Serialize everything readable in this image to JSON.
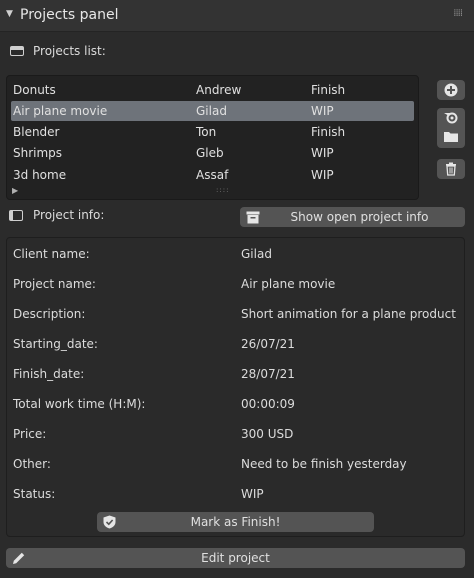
{
  "panel": {
    "title": "Projects panel"
  },
  "projects_list": {
    "label": "Projects list:",
    "rows": [
      {
        "name": "Donuts",
        "client": "Andrew",
        "status": "Finish"
      },
      {
        "name": "Air plane movie",
        "client": "Gilad",
        "status": "WIP"
      },
      {
        "name": "Blender",
        "client": "Ton",
        "status": "Finish"
      },
      {
        "name": "Shrimps",
        "client": "Gleb",
        "status": "WIP"
      },
      {
        "name": "3d home",
        "client": "Assaf",
        "status": "WIP"
      }
    ],
    "selected_index": 1
  },
  "side_buttons": {
    "add": "plus-circle-icon",
    "blender": "blender-logo-icon",
    "folder": "folder-icon",
    "delete": "trash-icon"
  },
  "project_info": {
    "label": "Project info:",
    "show_button": "Show open project info",
    "fields": [
      {
        "key": "Client name:",
        "value": "Gilad"
      },
      {
        "key": "Project name:",
        "value": "Air plane movie"
      },
      {
        "key": "Description:",
        "value": "Short animation for a plane product"
      },
      {
        "key": "Starting_date:",
        "value": "26/07/21"
      },
      {
        "key": "Finish_date:",
        "value": "28/07/21"
      },
      {
        "key": "Total work time (H:M):",
        "value": "00:00:09"
      },
      {
        "key": "Price:",
        "value": "300 USD"
      },
      {
        "key": "Other:",
        "value": "Need to be finish yesterday"
      },
      {
        "key": "Status:",
        "value": "WIP"
      }
    ],
    "mark_button": "Mark as Finish!"
  },
  "footer": {
    "edit_button": "Edit project"
  },
  "colors": {
    "background": "#2b2b2b",
    "button": "#545454",
    "selected_row": "#6e737a",
    "list_bg": "#222222"
  }
}
